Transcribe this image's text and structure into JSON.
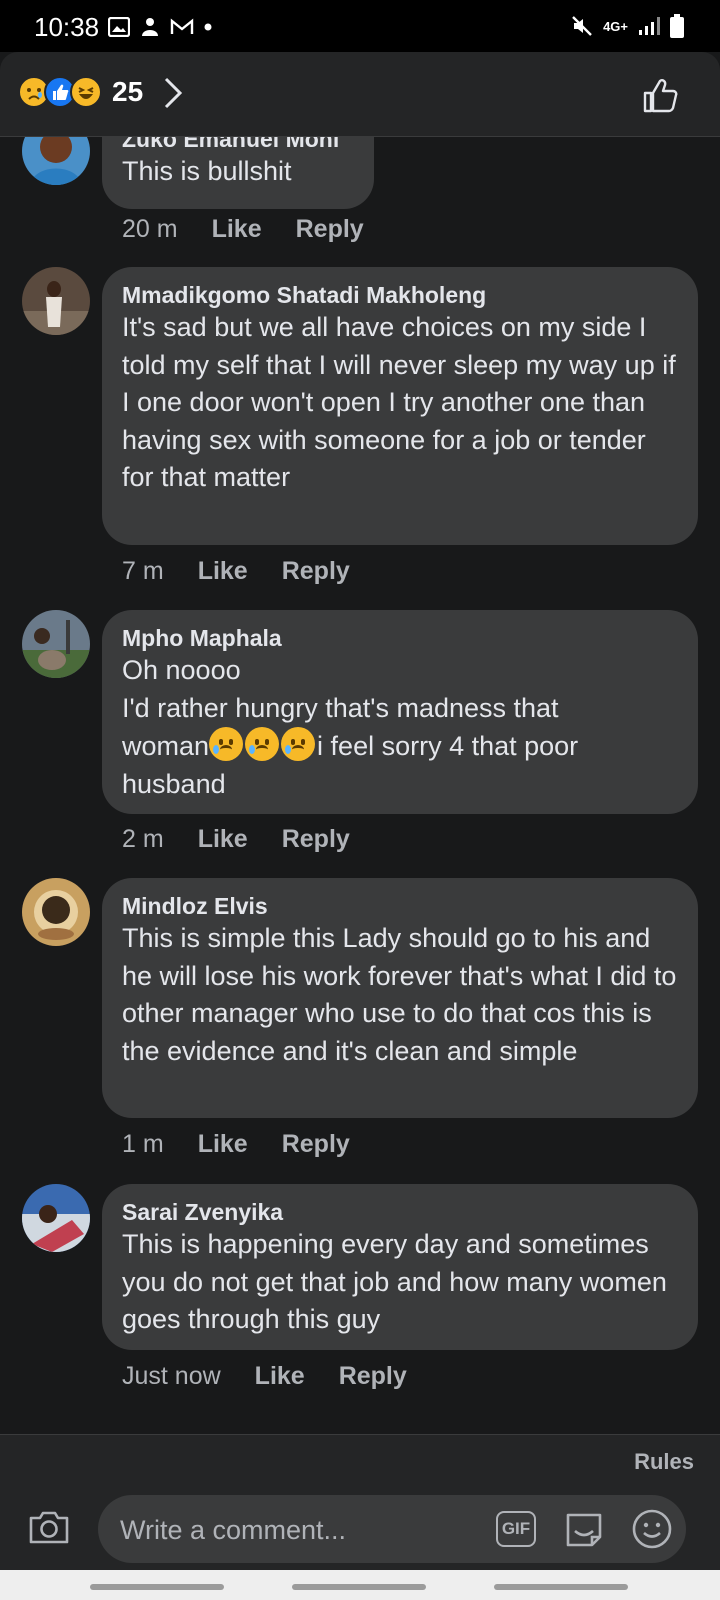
{
  "status_bar": {
    "time": "10:38",
    "network": "4G+",
    "left_icons": [
      "image-icon",
      "notification-icon",
      "gmail-icon",
      "dot-icon"
    ],
    "right_icons": [
      "mute-icon",
      "network-icon",
      "signal-icon",
      "battery-icon"
    ]
  },
  "header": {
    "reactions": [
      "sad",
      "like",
      "haha"
    ],
    "reaction_count": "25"
  },
  "comments": [
    {
      "author": "Zuko Emanuel Moni",
      "text": "This is bullshit",
      "time": "20 m",
      "like_label": "Like",
      "reply_label": "Reply"
    },
    {
      "author": "Mmadikgomo Shatadi Makholeng",
      "text": "It's sad but we all have choices on my side I told my self that I will never sleep my way up if I one door won't open I try another one than having sex with someone for a job or tender for that matter",
      "time": "7 m",
      "like_label": "Like",
      "reply_label": "Reply"
    },
    {
      "author": "Mpho Maphala",
      "text_line1": "Oh noooo",
      "text_line2": "I'd rather hungry that's madness that",
      "text_line3_prefix": "woman",
      "text_line3_suffix": "i feel sorry 4 that poor",
      "text_line4": "husband",
      "time": "2 m",
      "like_label": "Like",
      "reply_label": "Reply"
    },
    {
      "author": "Mindloz Elvis",
      "text": "This is simple this Lady should go to his and he will lose his work forever that's what I did to other manager who use to do that cos this is the evidence and it's clean and simple",
      "time": "1 m",
      "like_label": "Like",
      "reply_label": "Reply"
    },
    {
      "author": "Sarai Zvenyika",
      "text": "This is happening every day and sometimes you do not get that job and how many women goes through this guy",
      "time": "Just now",
      "like_label": "Like",
      "reply_label": "Reply"
    }
  ],
  "composer": {
    "rules_label": "Rules",
    "placeholder": "Write a comment...",
    "gif_label": "GIF"
  },
  "colors": {
    "background": "#18191a",
    "bubble": "#3a3b3c",
    "text": "#e4e6eb",
    "secondary_text": "#b0b3b8",
    "like_blue": "#1877f2"
  }
}
